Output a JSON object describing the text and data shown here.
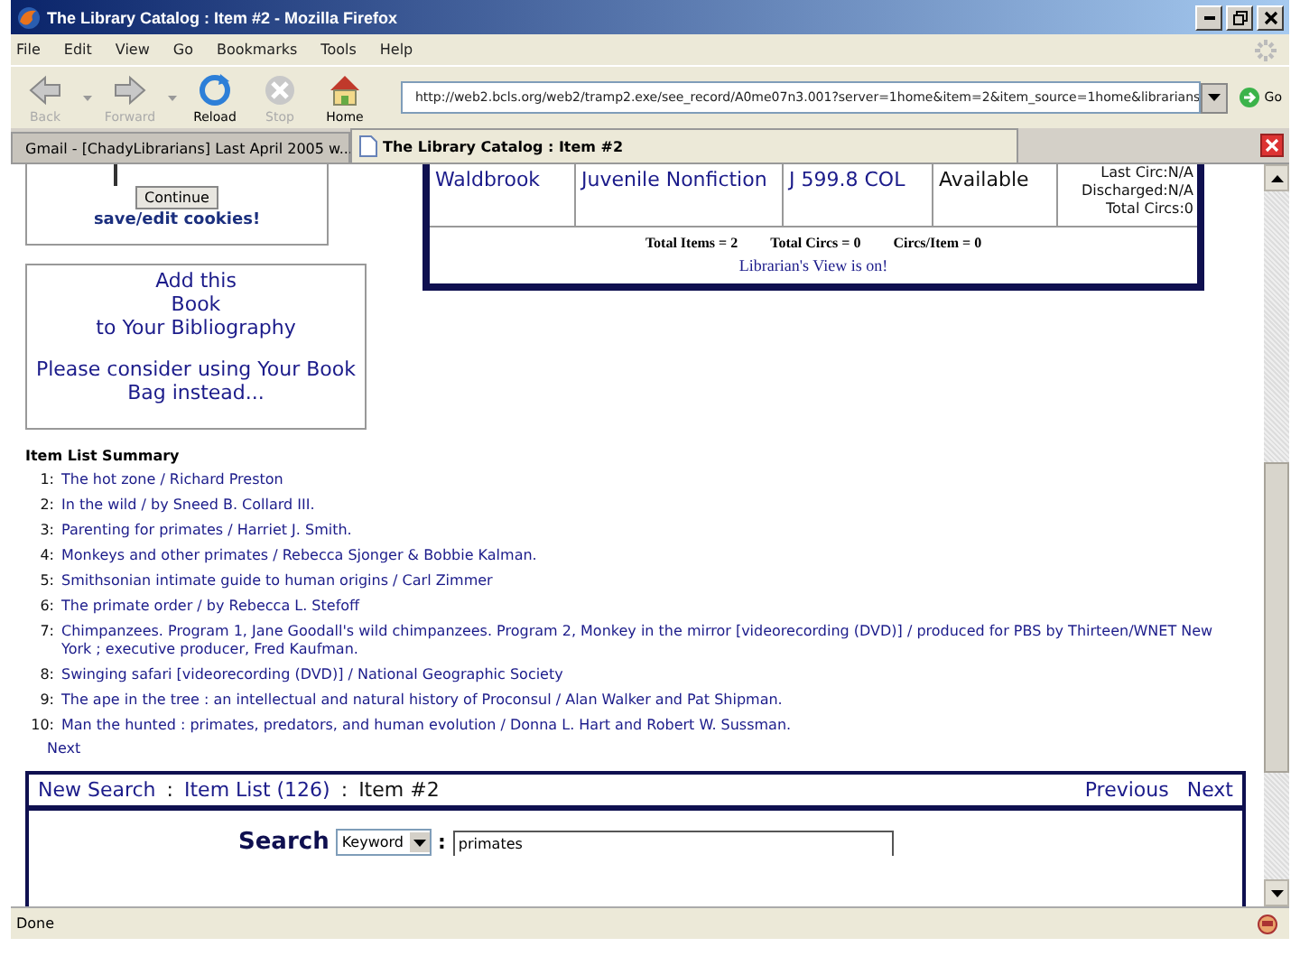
{
  "window": {
    "title": "The Library Catalog : Item #2 - Mozilla Firefox"
  },
  "menu": [
    "File",
    "Edit",
    "View",
    "Go",
    "Bookmarks",
    "Tools",
    "Help"
  ],
  "toolbar": [
    {
      "label": "Back",
      "disabled": true,
      "kind": "back"
    },
    {
      "label": "Forward",
      "disabled": true,
      "kind": "forward"
    },
    {
      "label": "Reload",
      "disabled": false,
      "kind": "reload"
    },
    {
      "label": "Stop",
      "disabled": true,
      "kind": "stop"
    },
    {
      "label": "Home",
      "disabled": false,
      "kind": "home"
    }
  ],
  "address": {
    "value": "http://web2.bcls.org/web2/tramp2.exe/see_record/A0me07n3.001?server=1home&item=2&item_source=1home&librarians"
  },
  "go_label": "Go",
  "tabs": [
    {
      "label": "Gmail - [ChadyLibrarians] Last April 2005 w...",
      "selected": false,
      "kind": "mail"
    },
    {
      "label": "The Library Catalog : Item #2",
      "selected": true,
      "kind": "page"
    }
  ],
  "cookie_box": {
    "button": "Continue",
    "link": "save/edit cookies!"
  },
  "bibliography_box": {
    "title": "Add this\nBook\nto Your Bibliography",
    "note": "Please consider using Your Book Bag instead..."
  },
  "holdings": {
    "row": [
      "Waldbrook",
      "Juvenile Nonfiction",
      "J 599.8 COL",
      "Available"
    ],
    "circ": [
      "Last Circ:N/A",
      "Discharged:N/A",
      "Total Circs:0"
    ],
    "totals": [
      "Total Items = 2",
      "Total Circs = 0",
      "Circs/Item = 0"
    ],
    "librarian_note": "Librarian's View is on!"
  },
  "item_list": {
    "heading": "Item List Summary",
    "items": [
      {
        "number": "1:",
        "text": "The hot zone / Richard Preston"
      },
      {
        "number": "2:",
        "text": "In the wild / by Sneed B. Collard III."
      },
      {
        "number": "3:",
        "text": "Parenting for primates / Harriet J. Smith."
      },
      {
        "number": "4:",
        "text": "Monkeys and other primates / Rebecca Sjonger & Bobbie Kalman."
      },
      {
        "number": "5:",
        "text": "Smithsonian intimate guide to human origins / Carl Zimmer"
      },
      {
        "number": "6:",
        "text": "The primate order / by Rebecca L. Stefoff"
      },
      {
        "number": "7:",
        "text": "Chimpanzees. Program 1, Jane Goodall's wild chimpanzees. Program 2, Monkey in the mirror [videorecording (DVD)] / produced for PBS by Thirteen/WNET New York ; executive producer, Fred Kaufman."
      },
      {
        "number": "8:",
        "text": "Swinging safari [videorecording (DVD)] / National Geographic Society"
      },
      {
        "number": "9:",
        "text": "The ape in the tree : an intellectual and natural history of Proconsul / Alan Walker and Pat Shipman."
      },
      {
        "number": "10:",
        "text": "Man the hunted : primates, predators, and human evolution / Donna L. Hart and Robert W. Sussman."
      }
    ],
    "next": "Next"
  },
  "nav": {
    "links": [
      "New Search",
      "Item List (126)"
    ],
    "current": "Item #2",
    "separator": ":",
    "pager": [
      "Previous",
      "Next"
    ]
  },
  "search": {
    "label": "Search",
    "select": "Keyword",
    "colon": ":",
    "value": "primates"
  },
  "status_bar": {
    "text": "Done"
  }
}
